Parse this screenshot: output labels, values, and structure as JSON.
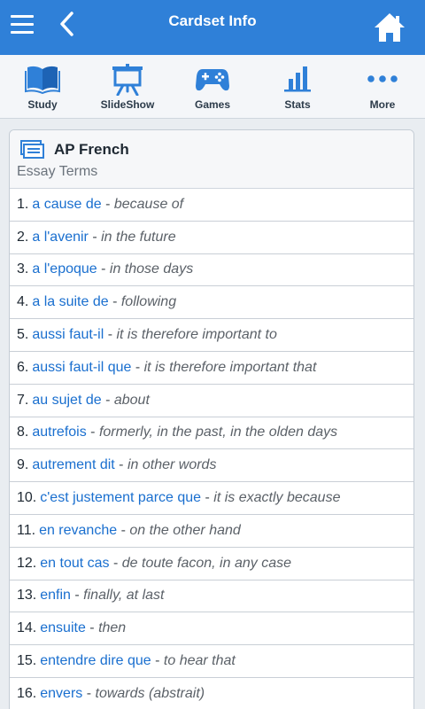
{
  "header": {
    "title": "Cardset Info",
    "menu_icon": "hamburger-menu-icon",
    "back_icon": "chevron-left-icon",
    "home_icon": "home-icon",
    "bar_color": "#2f80d8"
  },
  "toolbar": {
    "items": [
      {
        "label": "Study",
        "icon": "book-icon"
      },
      {
        "label": "SlideShow",
        "icon": "presentation-board-icon"
      },
      {
        "label": "Games",
        "icon": "gamepad-icon"
      },
      {
        "label": "Stats",
        "icon": "bar-chart-icon"
      },
      {
        "label": "More",
        "icon": "more-dots-icon"
      }
    ],
    "accent_color": "#2f80d8"
  },
  "cardset": {
    "title": "AP French",
    "subtitle": "Essay Terms",
    "icon": "cards-icon",
    "terms": [
      {
        "num": "1.",
        "term": "a cause de",
        "sep": " - ",
        "def": "because of"
      },
      {
        "num": "2.",
        "term": "a l'avenir",
        "sep": " - ",
        "def": "in the future"
      },
      {
        "num": "3.",
        "term": "a l'epoque",
        "sep": " - ",
        "def": "in those days"
      },
      {
        "num": "4.",
        "term": "a la suite de",
        "sep": " - ",
        "def": "following"
      },
      {
        "num": "5.",
        "term": "aussi faut-il",
        "sep": " - ",
        "def": "it is therefore important to"
      },
      {
        "num": "6.",
        "term": "aussi faut-il que",
        "sep": " - ",
        "def": "it is therefore important that"
      },
      {
        "num": "7.",
        "term": "au sujet de",
        "sep": " - ",
        "def": "about"
      },
      {
        "num": "8.",
        "term": "autrefois",
        "sep": " - ",
        "def": "formerly, in the past, in the olden days"
      },
      {
        "num": "9.",
        "term": "autrement dit",
        "sep": " - ",
        "def": "in other words"
      },
      {
        "num": "10.",
        "term": "c'est justement parce que",
        "sep": " - ",
        "def": "it is exactly because"
      },
      {
        "num": "11.",
        "term": "en revanche",
        "sep": " - ",
        "def": "on the other hand"
      },
      {
        "num": "12.",
        "term": "en tout cas",
        "sep": " - ",
        "def": "de toute facon, in any case"
      },
      {
        "num": "13.",
        "term": "enfin",
        "sep": " - ",
        "def": "finally, at last"
      },
      {
        "num": "14.",
        "term": "ensuite",
        "sep": " - ",
        "def": "then"
      },
      {
        "num": "15.",
        "term": "entendre dire que",
        "sep": " - ",
        "def": "to hear that"
      },
      {
        "num": "16.",
        "term": "envers",
        "sep": " - ",
        "def": "towards (abstrait)"
      }
    ]
  }
}
